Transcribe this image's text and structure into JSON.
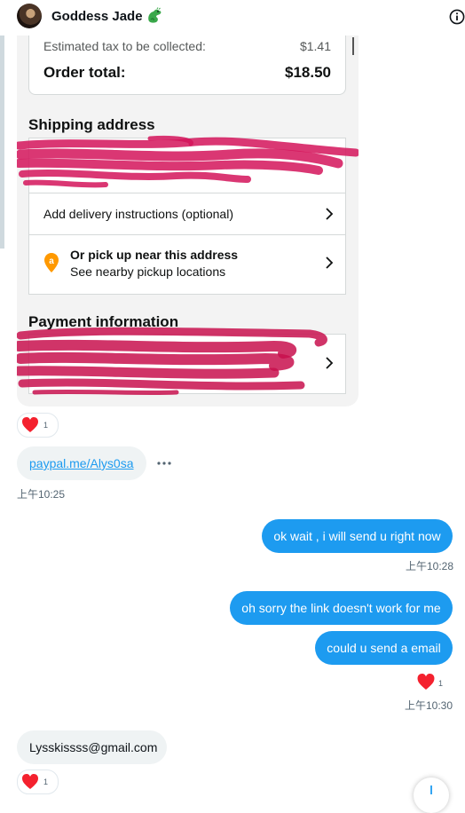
{
  "header": {
    "contact_name": "Goddess Jade",
    "name_emoji_icon": "dragon-icon",
    "info_icon": "info-icon"
  },
  "shared_image": {
    "estimated_tax_label": "Estimated tax to be collected:",
    "estimated_tax_value": "$1.41",
    "order_total_label": "Order total:",
    "order_total_value": "$18.50",
    "shipping_heading": "Shipping address",
    "delivery_instructions": "Add delivery instructions (optional)",
    "pickup_title": "Or pick up near this address",
    "pickup_subtitle": "See nearby pickup locations",
    "payment_heading": "Payment information",
    "scribble_color": "#d4145a"
  },
  "messages": {
    "image_reaction_count": "1",
    "link_text": "paypal.me/Alys0sa",
    "link_time": "上午10:25",
    "out_1": "ok wait , i will send u right now",
    "out_1_time": "上午10:28",
    "out_2": "oh sorry the link doesn't work for me",
    "out_3": "could u send a email",
    "out_3_reaction_count": "1",
    "out_3_time": "上午10:30",
    "email_text": "Lysskissss@gmail.com",
    "email_reaction_count": "1"
  },
  "colors": {
    "accent_blue": "#1d9bf0",
    "heart_red": "#f4212e",
    "incoming_bubble": "#eff3f4"
  }
}
